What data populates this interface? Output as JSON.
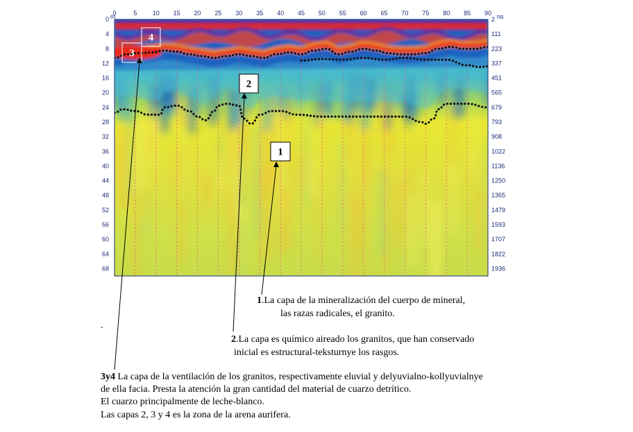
{
  "chart_data": {
    "type": "heatmap",
    "x_ticks": [
      0,
      5,
      10,
      15,
      20,
      25,
      30,
      35,
      40,
      45,
      50,
      55,
      60,
      65,
      70,
      75,
      80,
      85,
      90
    ],
    "x_unit": "m",
    "y_ticks": [
      0,
      4,
      8,
      12,
      16,
      20,
      24,
      28,
      32,
      36,
      40,
      44,
      48,
      52,
      56,
      60,
      64,
      68
    ],
    "y_right_ticks": [
      2,
      111,
      223,
      337,
      451,
      565,
      679,
      793,
      908,
      1022,
      1136,
      1250,
      1365,
      1479,
      1593,
      1707,
      1822,
      1936
    ],
    "y_right_unit": "ns",
    "xlim": [
      0,
      90
    ],
    "ylim": [
      0,
      70
    ],
    "vertical_grid_every": 5,
    "boundary_upper": {
      "x": [
        0,
        3,
        6,
        9,
        12,
        15,
        18,
        21,
        24,
        27,
        30,
        33,
        36,
        39,
        42,
        45,
        48,
        51,
        54,
        57,
        60,
        63,
        66,
        69,
        72,
        75,
        78,
        81,
        84,
        87,
        90
      ],
      "y": [
        10.5,
        9.5,
        9.2,
        9,
        8.5,
        8.8,
        9.5,
        10,
        10.5,
        10,
        9.5,
        10,
        10.5,
        9.5,
        9,
        9.5,
        8.5,
        8,
        9.5,
        8.8,
        8,
        8.5,
        9.2,
        9.5,
        9.5,
        9.2,
        8,
        7.5,
        8,
        8,
        7.5
      ]
    },
    "boundary_middle": {
      "x": [
        0,
        5,
        10,
        15,
        20,
        25,
        30,
        35,
        40,
        45,
        50,
        55,
        60,
        65,
        70,
        75,
        80,
        85,
        88,
        90
      ],
      "y": [
        11.5,
        12,
        12.5,
        12.2,
        12,
        11.8,
        11.5,
        11.5,
        11,
        11.2,
        10.8,
        11,
        10.5,
        11,
        10.5,
        11,
        11,
        12.5,
        13,
        12.8
      ],
      "x_start": 45
    },
    "boundary_lower": {
      "x": [
        0,
        2,
        5,
        8,
        11,
        12,
        15,
        18,
        20,
        22,
        24,
        25,
        27,
        30,
        31,
        33,
        35,
        38,
        40,
        44,
        50,
        55,
        60,
        65,
        70,
        74,
        75,
        77,
        78,
        80,
        85,
        90
      ],
      "y": [
        25.5,
        24.5,
        25,
        26,
        26,
        24,
        23.5,
        25,
        26.5,
        27.5,
        25,
        23.5,
        23,
        23.5,
        27,
        28.5,
        26,
        25,
        25,
        26,
        26.5,
        26.5,
        26.5,
        26.5,
        26.5,
        28,
        28.5,
        27,
        24.5,
        23,
        23,
        24
      ]
    },
    "annotations": [
      {
        "label": "1",
        "x": 40,
        "depth": 35,
        "text_ref": "cap1"
      },
      {
        "label": "2",
        "x": 30.5,
        "depth": 17,
        "text_ref": "cap2"
      },
      {
        "label": "3",
        "x": 4,
        "depth": 10,
        "text_ref": "cap34"
      },
      {
        "label": "4",
        "x": 9,
        "depth": 4,
        "text_ref": "cap34"
      }
    ]
  },
  "captions": {
    "cap1_num": "1",
    "cap1_line1": ".La capa de la mineralización del cuerpo de mineral,",
    "cap1_line2": "las razas radicales, el granito.",
    "cap2_num": "2",
    "cap2_line1": ".La capa es químico aireado los granitos, que han conservado",
    "cap2_line2": "inicial  es estructural-teksturnye los rasgos.",
    "dot": ".",
    "cap34_num": "3y4",
    "cap34_line1": "  La capa de la ventilación de los granitos, respectivamente eluvial y delyuvialno-kollyuvialnye",
    "cap34_line2": "de ella facia. Presta la atención la gran cantidad del material de cuarzo detrítico.",
    "cap34_line3": "El cuarzo principalmente de leche-blanco.",
    "cap34_line4": "Las capas 2, 3 y 4 es la zona de la arena aurifera."
  },
  "colors": {
    "deep": "#e8e832",
    "mid_green": "#7ed07a",
    "cyan": "#2ab0d8",
    "blue": "#1e3aa8",
    "purple": "#4a2a9a",
    "red": "#e82a1a",
    "orange": "#f08a2a",
    "grid": "#e8368a",
    "axis_text": "#1a2a7a"
  }
}
